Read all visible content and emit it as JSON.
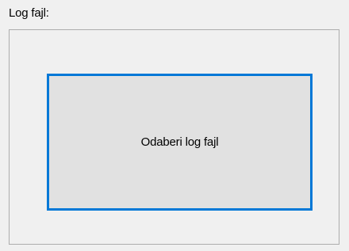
{
  "log_file_group": {
    "label": "Log fajl:",
    "select_button_label": "Odaberi log fajl"
  },
  "colors": {
    "window_background": "#f0f0f0",
    "group_border": "#adadad",
    "button_background": "#e1e1e1",
    "button_focus_border": "#0078d7"
  }
}
